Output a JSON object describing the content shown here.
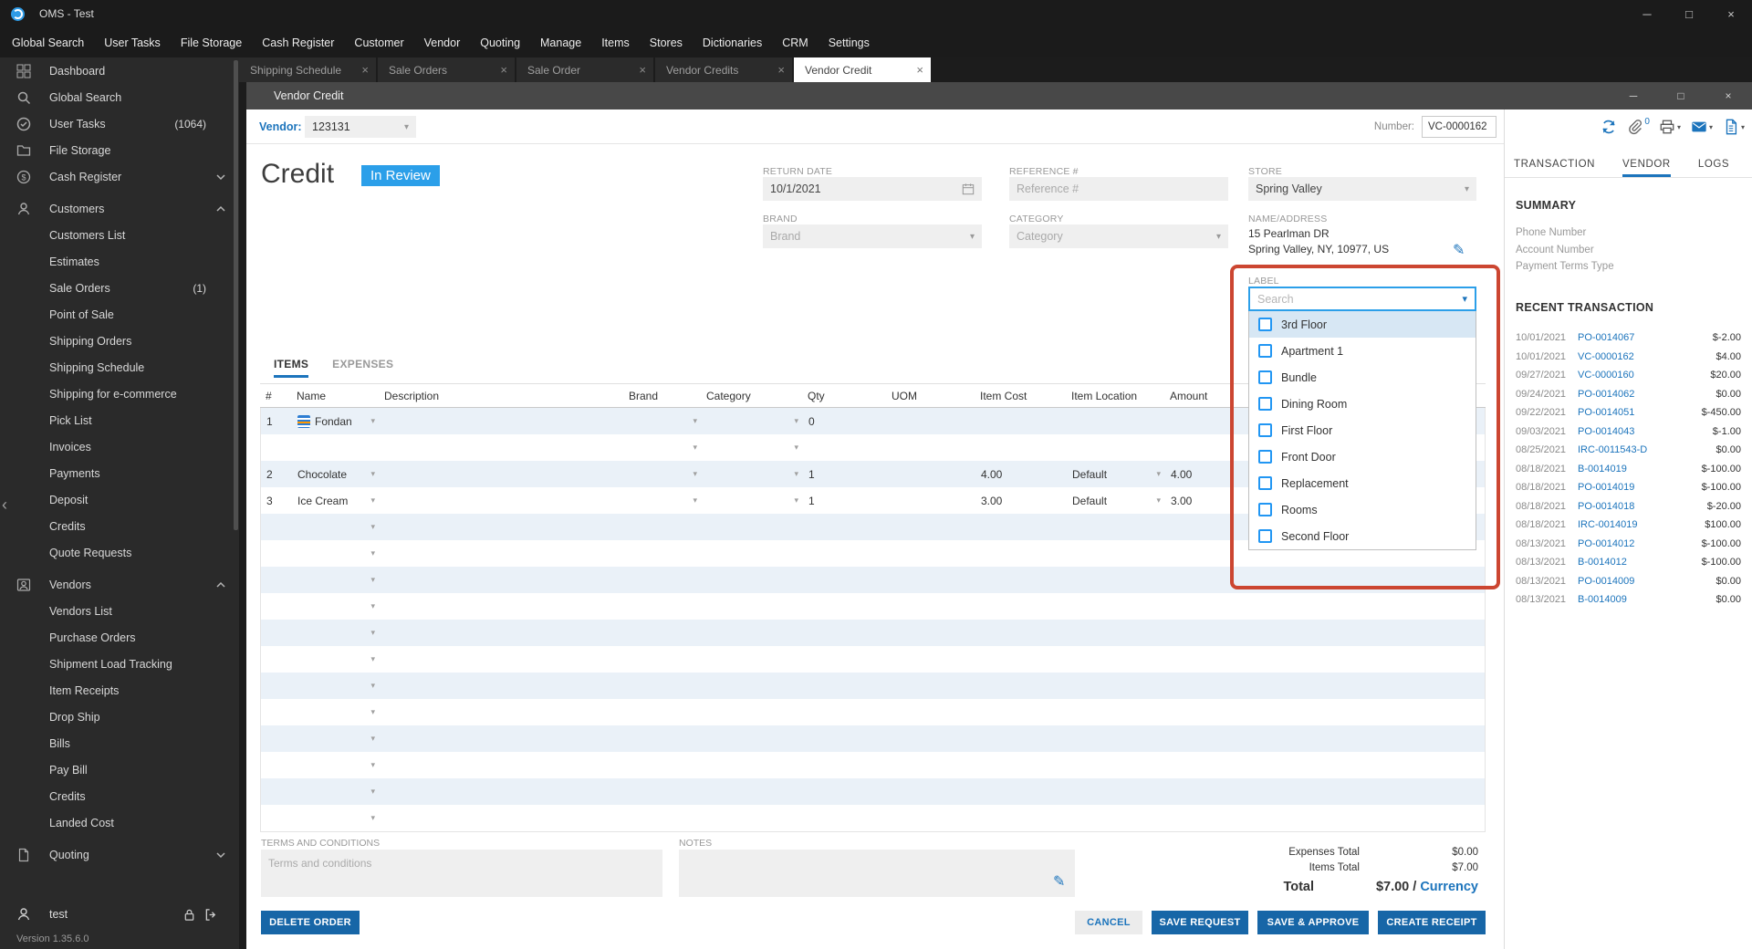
{
  "colors": {
    "accent": "#1c74bc",
    "button_blue": "#1766a7",
    "badge_blue": "#2b9fe9",
    "annotation_red": "#cc4631",
    "row_stripe": "#eaf1f8"
  },
  "titlebar": {
    "title": "OMS - Test"
  },
  "menu": {
    "items": [
      "Global Search",
      "User Tasks",
      "File Storage",
      "Cash Register",
      "Customer",
      "Vendor",
      "Quoting",
      "Manage",
      "Items",
      "Stores",
      "Dictionaries",
      "CRM",
      "Settings"
    ]
  },
  "doc_tabs": [
    {
      "label": "Shipping Schedule"
    },
    {
      "label": "Sale Orders"
    },
    {
      "label": "Sale Order"
    },
    {
      "label": "Vendor Credits"
    },
    {
      "label": "Vendor Credit",
      "active": true
    }
  ],
  "sidebar": {
    "items": [
      {
        "label": "Dashboard",
        "icon": "dashboard-icon"
      },
      {
        "label": "Global Search",
        "icon": "search-icon"
      },
      {
        "label": "User Tasks",
        "icon": "tasks-icon",
        "badge": "(1064)"
      },
      {
        "label": "File Storage",
        "icon": "storage-icon"
      },
      {
        "label": "Cash Register",
        "icon": "cash-icon",
        "chevron": "chevron-down-icon"
      },
      {
        "label": "Customers",
        "icon": "customers-icon",
        "chevron": "chevron-up-icon",
        "header": true
      },
      {
        "label": "Customers List"
      },
      {
        "label": "Estimates"
      },
      {
        "label": "Sale Orders",
        "badge": "(1)"
      },
      {
        "label": "Point of Sale"
      },
      {
        "label": "Shipping Orders"
      },
      {
        "label": "Shipping Schedule"
      },
      {
        "label": "Shipping for e-commerce"
      },
      {
        "label": "Pick List"
      },
      {
        "label": "Invoices"
      },
      {
        "label": "Payments"
      },
      {
        "label": "Deposit"
      },
      {
        "label": "Credits"
      },
      {
        "label": "Quote Requests"
      },
      {
        "label": "Vendors",
        "icon": "vendors-icon",
        "chevron": "chevron-up-icon",
        "header": true
      },
      {
        "label": "Vendors List"
      },
      {
        "label": "Purchase Orders"
      },
      {
        "label": "Shipment Load Tracking"
      },
      {
        "label": "Item Receipts"
      },
      {
        "label": "Drop Ship"
      },
      {
        "label": "Bills"
      },
      {
        "label": "Pay Bill"
      },
      {
        "label": "Credits"
      },
      {
        "label": "Landed Cost"
      },
      {
        "label": "Quoting",
        "icon": "quoting-icon",
        "chevron": "chevron-down-icon",
        "header": true
      }
    ],
    "user": "test",
    "version": "Version 1.35.6.0"
  },
  "window": {
    "title": "Vendor Credit",
    "vendor_label": "Vendor:",
    "vendor_value": "123131",
    "number_label": "Number:",
    "number_value": "VC-0000162"
  },
  "credit": {
    "title": "Credit",
    "status": "In Review"
  },
  "form": {
    "return_date": {
      "label": "RETURN DATE",
      "value": "10/1/2021"
    },
    "reference": {
      "label": "REFERENCE #",
      "placeholder": "Reference #"
    },
    "store": {
      "label": "STORE",
      "value": "Spring Valley"
    },
    "brand": {
      "label": "BRAND",
      "placeholder": "Brand"
    },
    "category": {
      "label": "CATEGORY",
      "placeholder": "Category"
    },
    "name_address": {
      "label": "NAME/ADDRESS",
      "line1": "15 Pearlman DR",
      "line2": "Spring Valley, NY, 10977, US"
    }
  },
  "label_dropdown": {
    "label": "LABEL",
    "search_placeholder": "Search",
    "options": [
      "3rd Floor",
      "Apartment 1",
      "Bundle",
      "Dining Room",
      "First Floor",
      "Front Door",
      "Replacement",
      "Rooms",
      "Second Floor"
    ]
  },
  "items_section": {
    "tabs": {
      "items": "ITEMS",
      "expenses": "EXPENSES"
    },
    "columns": [
      "#",
      "Name",
      "Description",
      "Brand",
      "Category",
      "Qty",
      "UOM",
      "Item Cost",
      "Item Location",
      "Amount"
    ],
    "rows": [
      {
        "num": "1",
        "name": "Fondan",
        "has_icon": true,
        "name_arrow": true,
        "brand_arrow": true,
        "cat_arrow": true,
        "qty": "0"
      },
      {
        "brand_arrow": true,
        "cat_arrow": true
      },
      {
        "num": "2",
        "name": "Chocolate",
        "name_arrow": true,
        "brand_arrow": true,
        "cat_arrow": true,
        "qty": "1",
        "item_cost": "4.00",
        "item_location": "Default",
        "loc_arrow": true,
        "amount": "4.00"
      },
      {
        "num": "3",
        "name": "Ice Cream",
        "name_arrow": true,
        "brand_arrow": true,
        "cat_arrow": true,
        "qty": "1",
        "item_cost": "3.00",
        "item_location": "Default",
        "loc_arrow": true,
        "amount": "3.00"
      },
      {
        "name_arrow": true
      },
      {
        "name_arrow": true
      },
      {
        "name_arrow": true
      },
      {
        "name_arrow": true
      },
      {
        "name_arrow": true
      },
      {
        "name_arrow": true
      },
      {
        "name_arrow": true
      },
      {
        "name_arrow": true
      },
      {
        "name_arrow": true
      },
      {
        "name_arrow": true
      },
      {
        "name_arrow": true
      },
      {
        "name_arrow": true
      }
    ]
  },
  "footer": {
    "terms": {
      "label": "TERMS AND CONDITIONS",
      "placeholder": "Terms and conditions"
    },
    "notes": {
      "label": "NOTES"
    },
    "totals": {
      "expenses_label": "Expenses Total",
      "expenses_value": "$0.00",
      "items_label": "Items Total",
      "items_value": "$7.00",
      "total_label": "Total",
      "total_value": "$7.00",
      "separator": " / ",
      "currency_link": "Currency"
    },
    "buttons": {
      "delete": "DELETE ORDER",
      "cancel": "CANCEL",
      "save_request": "SAVE REQUEST",
      "save_approve": "SAVE & APPROVE",
      "create_receipt": "CREATE RECEIPT"
    }
  },
  "right_panel": {
    "attachment_count": "0",
    "tabs": [
      {
        "label": "TRANSACTION"
      },
      {
        "label": "VENDOR",
        "active": true
      },
      {
        "label": "LOGS"
      }
    ],
    "summary": {
      "title": "SUMMARY",
      "fields": [
        "Phone Number",
        "Account Number",
        "Payment Terms Type"
      ]
    },
    "recent": {
      "title": "RECENT TRANSACTION",
      "rows": [
        {
          "date": "10/01/2021",
          "doc": "PO-0014067",
          "amount": "$-2.00"
        },
        {
          "date": "10/01/2021",
          "doc": "VC-0000162",
          "amount": "$4.00"
        },
        {
          "date": "09/27/2021",
          "doc": "VC-0000160",
          "amount": "$20.00"
        },
        {
          "date": "09/24/2021",
          "doc": "PO-0014062",
          "amount": "$0.00"
        },
        {
          "date": "09/22/2021",
          "doc": "PO-0014051",
          "amount": "$-450.00"
        },
        {
          "date": "09/03/2021",
          "doc": "PO-0014043",
          "amount": "$-1.00"
        },
        {
          "date": "08/25/2021",
          "doc": "IRC-0011543-D",
          "amount": "$0.00"
        },
        {
          "date": "08/18/2021",
          "doc": "B-0014019",
          "amount": "$-100.00"
        },
        {
          "date": "08/18/2021",
          "doc": "PO-0014019",
          "amount": "$-100.00"
        },
        {
          "date": "08/18/2021",
          "doc": "PO-0014018",
          "amount": "$-20.00"
        },
        {
          "date": "08/18/2021",
          "doc": "IRC-0014019",
          "amount": "$100.00"
        },
        {
          "date": "08/13/2021",
          "doc": "PO-0014012",
          "amount": "$-100.00"
        },
        {
          "date": "08/13/2021",
          "doc": "B-0014012",
          "amount": "$-100.00"
        },
        {
          "date": "08/13/2021",
          "doc": "PO-0014009",
          "amount": "$0.00"
        },
        {
          "date": "08/13/2021",
          "doc": "B-0014009",
          "amount": "$0.00"
        }
      ]
    }
  }
}
